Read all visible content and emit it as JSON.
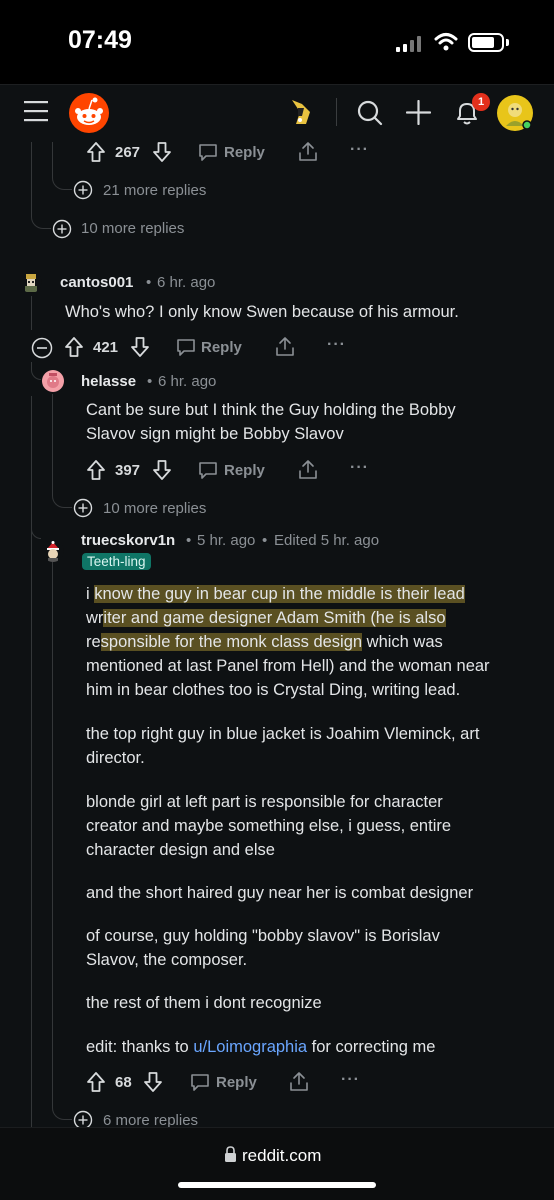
{
  "status_bar": {
    "time": "07:49"
  },
  "header": {
    "notification_count": "1"
  },
  "top_actions": {
    "votes": "267",
    "reply_label": "Reply"
  },
  "more_replies_a": "21 more replies",
  "more_replies_b": "10 more replies",
  "comment1": {
    "author": "cantos001",
    "meta": "6 hr. ago",
    "body": "Who's who? I only know Swen because of his armour.",
    "votes": "421",
    "reply_label": "Reply"
  },
  "comment2": {
    "author": "helasse",
    "meta": "6 hr. ago",
    "body_line1": "Cant be sure but I think the Guy holding the Bobby",
    "body_line2": "Slavov sign might be Bobby Slavov",
    "votes": "397",
    "reply_label": "Reply"
  },
  "more_replies_c": "10 more replies",
  "comment3": {
    "author": "truecskorv1n",
    "meta": "5 hr. ago",
    "edited": "Edited 5 hr. ago",
    "flair": "Teeth-ling",
    "p1_l1_a": "i ",
    "p1_l1_b": "know the guy in bear cup in the middle is their lead",
    "p1_l2_a": "wr",
    "p1_l2_b": "iter and game designer Adam Smith (he is also",
    "p1_l3_a": "re",
    "p1_l3_b": "sponsible for the monk class design",
    "p1_l3_c": " which was",
    "p1_l4": "mentioned at last Panel from Hell) and the woman near",
    "p1_l5": "him in bear clothes too is Crystal Ding, writing lead.",
    "p2_l1": "the top right guy in blue jacket is Joahim Vleminck, art",
    "p2_l2": "director.",
    "p3_l1": "blonde girl at left part is responsible for character",
    "p3_l2": "creator and maybe something else, i guess, entire",
    "p3_l3": "character design and else",
    "p4": "and the short haired guy near her is combat designer",
    "p5_l1": "of course, guy holding \"bobby slavov\" is Borislav",
    "p5_l2": "Slavov, the composer.",
    "p6": "the rest of them i dont recognize",
    "p7_a": "edit: thanks to ",
    "p7_link": "u/Loimographia",
    "p7_b": " for correcting me",
    "votes": "68",
    "reply_label": "Reply"
  },
  "more_replies_d": "6 more replies",
  "browser": {
    "url": "reddit.com"
  },
  "colors": {
    "background": "#0e1113",
    "brand": "#ff4500",
    "flair": "#0f7566",
    "link": "#6aa6ff"
  }
}
